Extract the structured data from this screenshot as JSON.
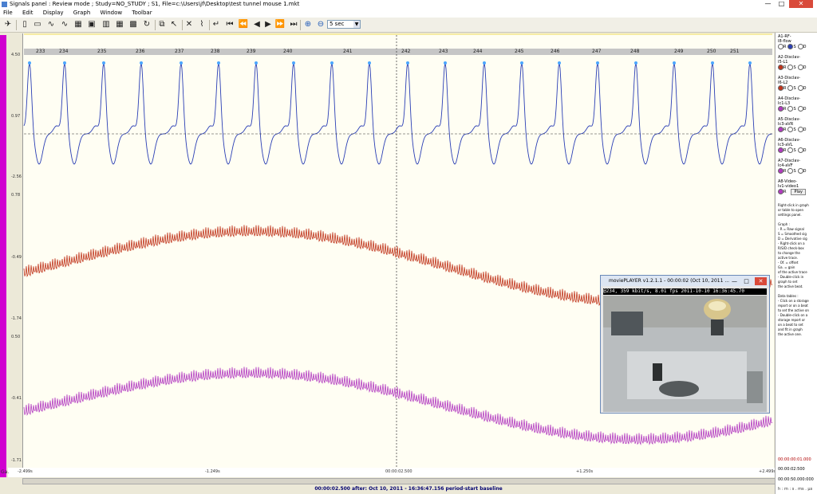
{
  "window": {
    "title": "Signals panel : Review mode ; Study=NO_STUDY ; S1, File=c:\\Users\\jf\\Desktop\\test tunnel mouse 1.mkt",
    "btn_min": "—",
    "btn_max": "□",
    "btn_close": "✕"
  },
  "menu": [
    "File",
    "Edit",
    "Display",
    "Graph",
    "Window",
    "Toolbar"
  ],
  "toolbar": {
    "zoom_value": "5 sec"
  },
  "beats": [
    "233",
    "234",
    "235",
    "236",
    "237",
    "238",
    "239",
    "240",
    "241",
    "242",
    "243",
    "244",
    "245",
    "246",
    "247",
    "248",
    "249",
    "250",
    "251"
  ],
  "y_labels": {
    "flow_top": "4.50",
    "flow_mid": "0.97",
    "flow_bot": "-2.56",
    "l1_top": "0.78",
    "l1_mid": "-0.49",
    "l1_bot": "-1.74",
    "l2_top": "0.50",
    "l2_mid": "-0.41",
    "l2_bot": "-1.71",
    "gain": "Ga."
  },
  "x_labels": [
    "-2.499s",
    "-1.249s",
    "00:00:02.500",
    "+1.250s",
    "+2.499s"
  ],
  "status": "00:00:02.500   after:  Oct 10, 2011 - 16:36:47.156 period-start baseline",
  "channels": [
    {
      "name": "A1-RF-",
      "sub": "I8-flow",
      "selected": "S"
    },
    {
      "name": "A2-Disclav-",
      "sub": "I5-L1",
      "selected": "R"
    },
    {
      "name": "A3-Disclav-",
      "sub": "I6-L2",
      "selected": "R"
    },
    {
      "name": "A4-Disclav-",
      "sub": "Ic1-L3",
      "selected": "R"
    },
    {
      "name": "A5-Disclav-",
      "sub": "Ic3-aVR",
      "selected": "R"
    },
    {
      "name": "A6-Disclav-",
      "sub": "Ic3-aVL",
      "selected": "R"
    },
    {
      "name": "A7-Disclav-",
      "sub": "Ic4-aVF",
      "selected": "R"
    },
    {
      "name": "A8-Video-",
      "sub": "Iv1-video1",
      "selected": "R"
    }
  ],
  "rsd": [
    "R",
    "S",
    "D"
  ],
  "play_label": "Play",
  "help": [
    "Right-click in graph",
    "or table to open",
    "settings panel.",
    "",
    "Graph :",
    "- R = Raw signal",
    "  S = Smoothed sig",
    "  D = Derivative sig",
    "- Right-click on a",
    "  R/S/D check-box",
    "  to change the",
    "  active trace.",
    "- Of. = offset",
    "  Ga. = gain",
    "  of the active trace",
    "- Double-click in",
    "  graph to set",
    "  the active beat.",
    "",
    "Data tables :",
    "- Click on a storage",
    "  report or on a beat",
    "  to set the active on",
    "- Double-click on a",
    "  storage report or",
    "  on a beat to set",
    "  and fit in graph",
    "  the active one."
  ],
  "right_times": [
    "00:00:00:01.000",
    "00:00:02:500",
    "00:00:50.000:000"
  ],
  "right_footer": "h : m : s . ms . µs",
  "player": {
    "title": "moviePLAYER v1.2.1.1 - 00:00:02 (Oct 10, 2011 ...",
    "info": "@234,  359 kbit/s,  8.01 fps 2011-10-10 16:36:45.70"
  },
  "colors": {
    "flow": "#2b3fb5",
    "l1": "#c0341b",
    "l2": "#b23ac0",
    "accent": "#d000d0"
  }
}
